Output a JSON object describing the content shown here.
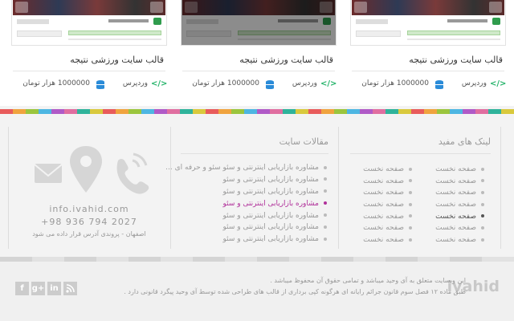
{
  "cards": [
    {
      "title": "قالب سایت ورزشی نتیجه",
      "category": "وردپرس",
      "price": "1000000 هزار تومان",
      "dimmed": false
    },
    {
      "title": "قالب سایت ورزشی نتیجه",
      "category": "وردپرس",
      "price": "1000000 هزار تومان",
      "dimmed": true
    },
    {
      "title": "قالب سایت ورزشی نتیجه",
      "category": "وردپرس",
      "price": "1000000 هزار تومان",
      "dimmed": false
    }
  ],
  "strip_colors": [
    "#e85b5b",
    "#f0a33e",
    "#9bc53d",
    "#4db6e2",
    "#b05ac7",
    "#e06ea0",
    "#2fb39b",
    "#d9c93c"
  ],
  "useful_links": {
    "title": "لینک های مفید",
    "col1": [
      "صفحه نخست",
      "صفحه نخست",
      "صفحه نخست",
      "صفحه نخست",
      "صفحه نخست",
      "صفحه نخست",
      "صفحه نخست"
    ],
    "col2": [
      "صفحه نخست",
      "صفحه نخست",
      "صفحه نخست",
      "صفحه نخست",
      "صفحه نخست",
      "صفحه نخست",
      "صفحه نخست"
    ]
  },
  "articles": {
    "title": "مقالات سایت",
    "items": [
      "مشاوره بازاریابی اینترنتی و سئو  سئو و حرفه ای ...",
      "مشاوره بازاریابی اینترنتی و سئو",
      "مشاوره بازاریابی اینترنتی و سئو",
      "مشاوره بازاریابی اینترنتی و سئو",
      "مشاوره بازاریابی اینترنتی و سئو",
      "مشاوره بازاریابی اینترنتی و سئو",
      "مشاوره بازاریابی اینترنتی و سئو"
    ]
  },
  "contact": {
    "email": "info.ivahid.com",
    "phone": "+98 936 794 2027",
    "address": "اصفهان - پروندی آدرس قرار داده می شود"
  },
  "bottom": {
    "logo": "ivahid",
    "copyright_line1": "این وبسایت متعلق به آی وحید میباشد و تمامی حقوق آن محفوظ میباشد .",
    "copyright_line2": "طبق ماده ۱۲ فصل سوم قانون جرائم رایانه ای هرگونه کپی برداری از قالب های طراحی شده توسط آی وحید پیگرد قانونی دارد .",
    "social": [
      "f",
      "g+",
      "in",
      "rss"
    ]
  }
}
